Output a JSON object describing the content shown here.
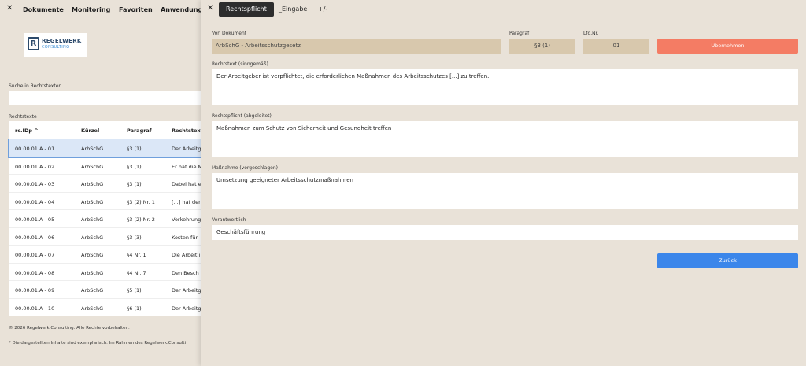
{
  "background": {
    "nav": {
      "close": "✕",
      "items": [
        "Dokumente",
        "Monitoring",
        "Favoriten",
        "Anwendungsb"
      ]
    },
    "logo": {
      "letter": "R",
      "name": "REGELWERK",
      "sub": "CONSULTING"
    },
    "search_label": "Suche in Rechtstexten",
    "search_value": "",
    "table_label": "Rechtstexte",
    "columns": [
      "rc.IDp ^",
      "Kürzel",
      "Paragraf",
      "Rechtstext"
    ],
    "rows": [
      [
        "00.00.01.A - 01",
        "ArbSchG",
        "§3 (1)",
        "Der Arbeitg"
      ],
      [
        "00.00.01.A - 02",
        "ArbSchG",
        "§3 (1)",
        "Er hat die M"
      ],
      [
        "00.00.01.A - 03",
        "ArbSchG",
        "§3 (1)",
        "Dabei hat e"
      ],
      [
        "00.00.01.A - 04",
        "ArbSchG",
        "§3 (2) Nr. 1",
        "[...] hat der"
      ],
      [
        "00.00.01.A - 05",
        "ArbSchG",
        "§3 (2) Nr. 2",
        "Vorkehrung"
      ],
      [
        "00.00.01.A - 06",
        "ArbSchG",
        "§3 (3)",
        "Kosten für"
      ],
      [
        "00.00.01.A - 07",
        "ArbSchG",
        "§4 Nr. 1",
        "Die Arbeit i"
      ],
      [
        "00.00.01.A - 08",
        "ArbSchG",
        "§4 Nr. 7",
        "Den Besch"
      ],
      [
        "00.00.01.A - 09",
        "ArbSchG",
        "§5 (1)",
        "Der Arbeitg"
      ],
      [
        "00.00.01.A - 10",
        "ArbSchG",
        "§6 (1)",
        "Der Arbeitg"
      ]
    ],
    "selected_row": 0,
    "copyright": "© 2026 Regelwerk.Consulting. Alle Rechte vorbehalten.",
    "disclaimer": "* Die dargestellten Inhalte sind exemplarisch. Im Rahmen des Regelwerk.Consulti"
  },
  "panel": {
    "close": "✕",
    "tabs": [
      "Rechtspflicht",
      "_Eingabe",
      "+/-"
    ],
    "active_tab": 0,
    "von_dokument_label": "Von Dokument",
    "von_dokument_value": "ArbSchG - Arbeitsschutzgesetz",
    "paragraf_label": "Paragraf",
    "paragraf_value": "§3 (1)",
    "lfdnr_label": "Lfd.Nr.",
    "lfdnr_value": "01",
    "uebernehmen_label": "Übernehmen",
    "rechtstext_label": "Rechtstext (sinngemäß)",
    "rechtstext_value": "Der Arbeitgeber ist verpflichtet, die erforderlichen Maßnahmen des Arbeitsschutzes [...] zu treffen.",
    "rechtspflicht_label": "Rechtspflicht (abgeleitet)",
    "rechtspflicht_value": "Maßnahmen zum Schutz von Sicherheit und Gesundheit treffen",
    "massnahme_label": "Maßnahme (vorgeschlagen)",
    "massnahme_value": "Umsetzung geeigneter Arbeitsschutzmaßnahmen",
    "verantwortlich_label": "Verantwortlich",
    "verantwortlich_value": "Geschäftsführung",
    "zurueck_label": "Zurück"
  },
  "colors": {
    "accent_orange": "#f47c64",
    "accent_blue": "#3b86ea",
    "tab_active": "#2d2d2d",
    "background": "#e9e2d8"
  }
}
